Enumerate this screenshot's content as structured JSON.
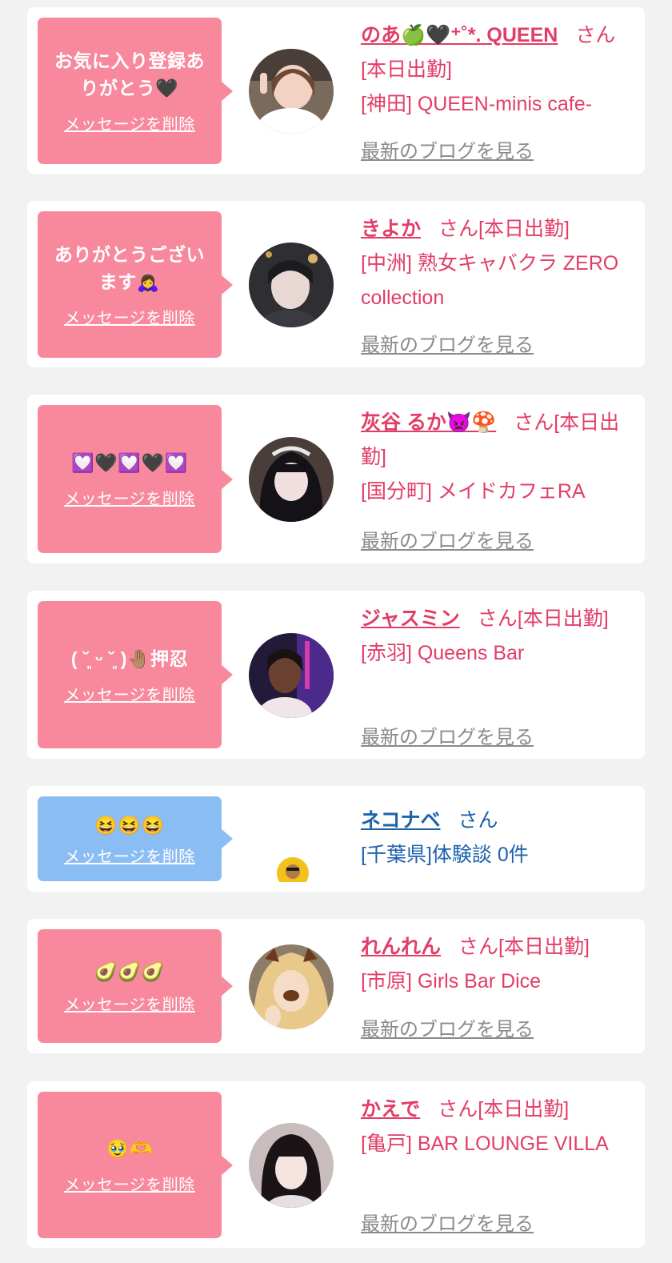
{
  "colors": {
    "page_background": "#f2f2f2",
    "card_background": "#ffffff",
    "pink_bubble": "#f8899d",
    "blue_bubble": "#8bbdf5",
    "cast_text": "#e23d67",
    "user_text": "#1d62ab",
    "blog_link": "#8a8a8a"
  },
  "delete_label": "メッセージを削除",
  "blog_label": "最新のブログを見る",
  "cards": [
    {
      "message": "お気に入り登録ありがとう🖤",
      "name": "のあ🍏🖤⁺˚*. QUEEN",
      "suffix": "さん[本日出勤]",
      "shop": "[神田] QUEEN-minis cafe-"
    },
    {
      "message": "ありがとうございます🙇‍♀️",
      "name": "きよか",
      "suffix": "さん[本日出勤]",
      "shop": "[中洲] 熟女キャバクラ ZERO collection"
    },
    {
      "message": "💟🖤💟🖤💟",
      "name": "灰谷 るか👿🍄",
      "suffix": "さん[本日出勤]",
      "shop": "[国分町] メイドカフェRA"
    },
    {
      "message": "( ˘͈ ᵕ ˘͈ )🤚🏽押忍",
      "name": "ジャスミン",
      "suffix": "さん[本日出勤]",
      "shop": "[赤羽] Queens Bar"
    },
    {
      "message": "😆😆😆",
      "name": "ネコナベ",
      "suffix": "さん",
      "shop": "[千葉県]体験談 0件"
    },
    {
      "message": "🥑🥑🥑",
      "name": "れんれん",
      "suffix": "さん[本日出勤]",
      "shop": "[市原] Girls Bar Dice"
    },
    {
      "message": "🥹🫶",
      "name": "かえで",
      "suffix": "さん[本日出勤]",
      "shop": "[亀戸] BAR LOUNGE VILLA"
    }
  ]
}
